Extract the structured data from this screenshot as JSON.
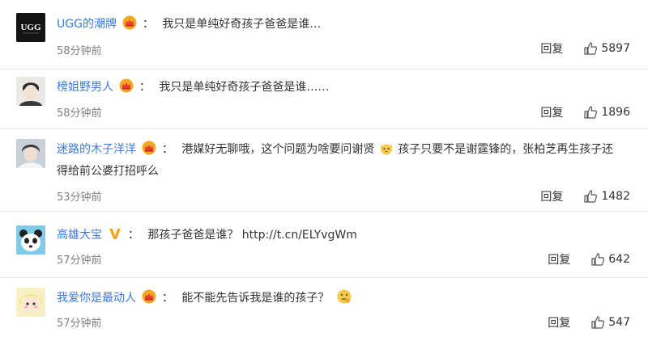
{
  "colors": {
    "username": "#3b7ad9",
    "meta": "#808080",
    "text": "#333333",
    "crown": "#f5a623"
  },
  "comments": [
    {
      "username": "UGG的潮牌",
      "badge": "crown-icon",
      "separator": "：",
      "text": "我只是单纯好奇孩子爸爸是谁…",
      "time": "58分钟前",
      "reply_label": "回复",
      "likes": "5897"
    },
    {
      "username": "榜姐野男人",
      "badge": "crown-icon",
      "separator": "：",
      "text": "我只是单纯好奇孩子爸爸是谁……",
      "time": "58分钟前",
      "reply_label": "回复",
      "likes": "1896"
    },
    {
      "username": "迷路的木子洋洋",
      "badge": "crown-icon",
      "separator": "：",
      "text_before": "港媒好无聊哦，这个问题为啥要问谢贤",
      "emoji": "cat-face-emoji",
      "text_after": "孩子只要不是谢霆锋的，张柏芝再生孩子还得给前公婆打招呼么",
      "time": "53分钟前",
      "reply_label": "回复",
      "likes": "1482"
    },
    {
      "username": "高雄大宝",
      "badge": "verified-v-icon",
      "separator": "：",
      "text": "那孩子爸爸是谁？ http://t.cn/ELYvgWm",
      "time": "57分钟前",
      "reply_label": "回复",
      "likes": "642"
    },
    {
      "username": "我爱你是最动人",
      "badge": "crown-icon",
      "separator": "：",
      "text_before": "能不能先告诉我是谁的孩子？",
      "emoji": "thinking-emoji",
      "time": "57分钟前",
      "reply_label": "回复",
      "likes": "547"
    }
  ]
}
